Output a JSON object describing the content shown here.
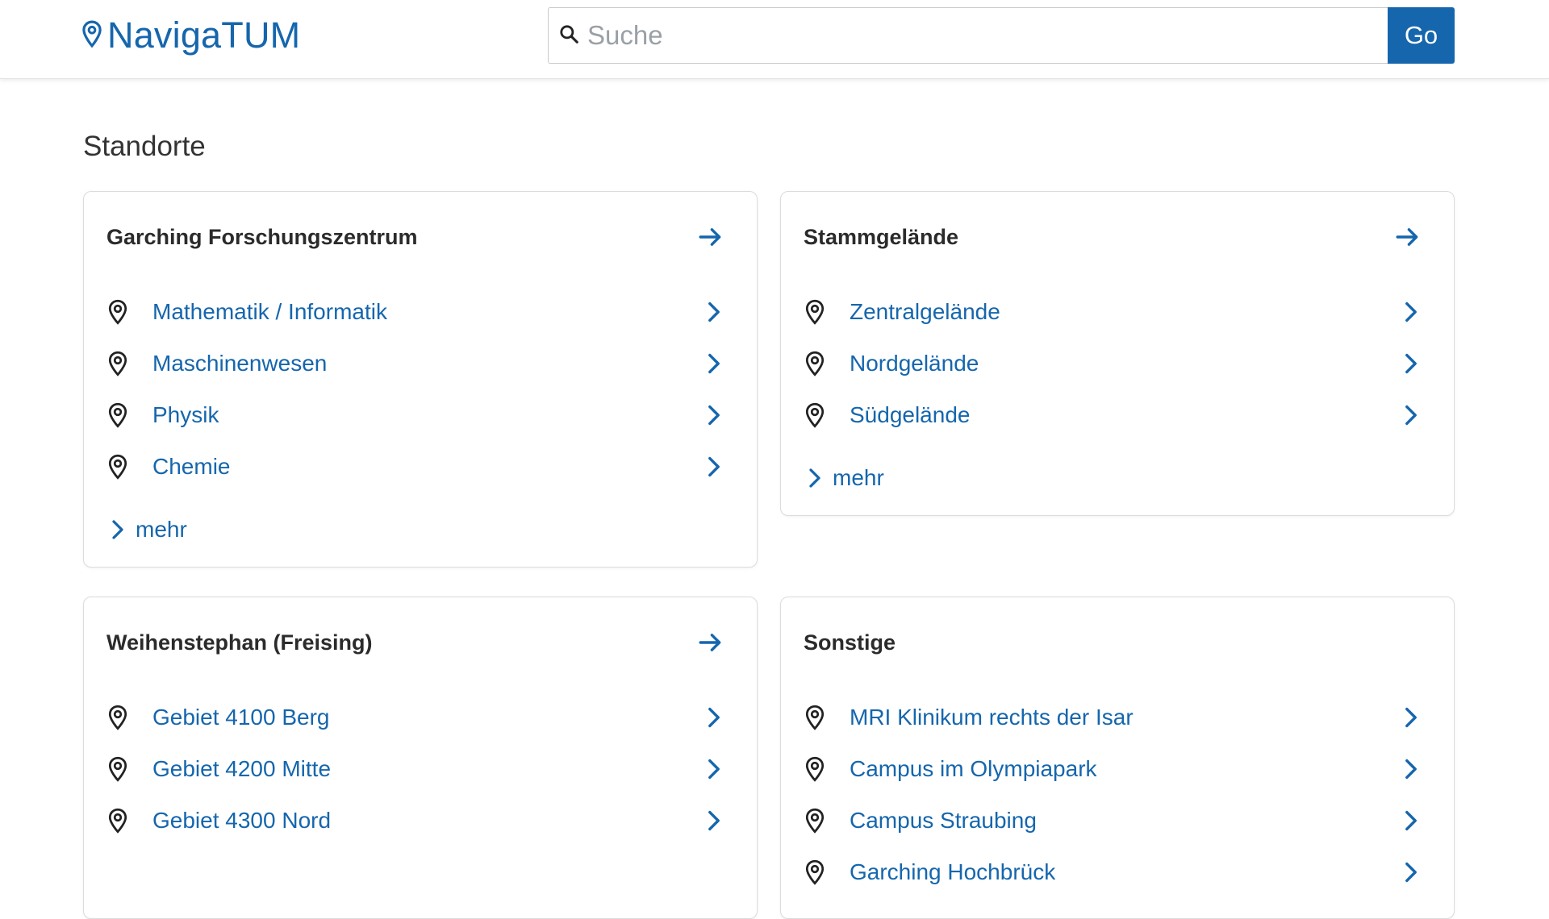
{
  "header": {
    "logo_text": "NavigaTUM",
    "search_placeholder": "Suche",
    "go_label": "Go"
  },
  "section_title": "Standorte",
  "cards": [
    {
      "title": "Garching Forschungszentrum",
      "items": [
        "Mathematik / Informatik",
        "Maschinenwesen",
        "Physik",
        "Chemie"
      ],
      "more": "mehr"
    },
    {
      "title": "Stammgelände",
      "items": [
        "Zentralgelände",
        "Nordgelände",
        "Südgelände"
      ],
      "more": "mehr"
    },
    {
      "title": "Weihenstephan (Freising)",
      "items": [
        "Gebiet 4100 Berg",
        "Gebiet 4200 Mitte",
        "Gebiet 4300 Nord"
      ]
    },
    {
      "title": "Sonstige",
      "items": [
        "MRI Klinikum rechts der Isar",
        "Campus im Olympiapark",
        "Campus Straubing",
        "Garching Hochbrück"
      ]
    }
  ],
  "colors": {
    "accent": "#1566ad",
    "text_dark": "#2b2b2b",
    "border": "#dcdcdc"
  },
  "icons": {
    "logo": "map-pin-icon",
    "search": "search-icon",
    "card_link": "arrow-right-icon",
    "item_marker": "map-pin-icon",
    "item_link": "chevron-right-icon"
  }
}
